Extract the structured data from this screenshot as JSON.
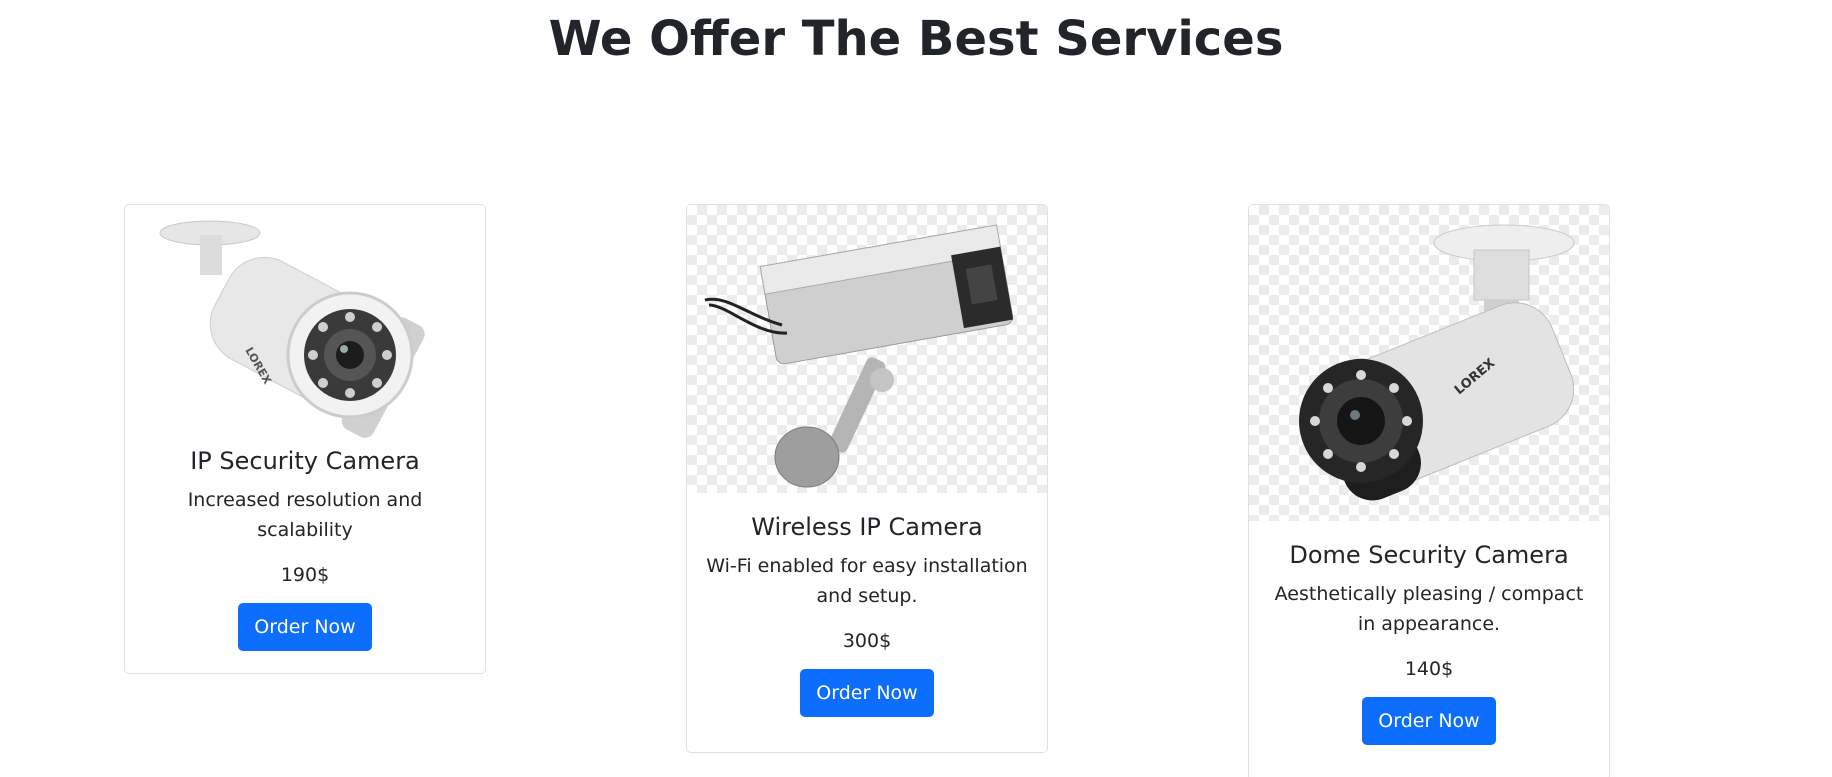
{
  "header": {
    "title": "We Offer The Best Services"
  },
  "cards": [
    {
      "title": "IP Security Camera",
      "description": "Increased resolution and scalability",
      "price": "190$",
      "button_label": "Order Now",
      "image_icon": "bullet-camera-icon"
    },
    {
      "title": "Wireless IP Camera",
      "description": "Wi-Fi enabled for easy installation and setup.",
      "price": "300$",
      "button_label": "Order Now",
      "image_icon": "box-camera-icon"
    },
    {
      "title": "Dome Security Camera",
      "description": "Aesthetically pleasing / compact in appearance.",
      "price": "140$",
      "button_label": "Order Now",
      "image_icon": "bullet-camera-icon"
    }
  ],
  "colors": {
    "accent": "#0d6efd",
    "text": "#212529",
    "border": "#dee2e6"
  }
}
